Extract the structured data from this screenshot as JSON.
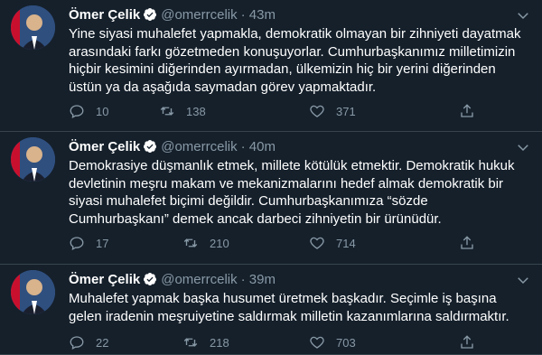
{
  "colors": {
    "background": "#15202b",
    "divider": "#38444d",
    "secondary_text": "#8899a6",
    "verified_badge": "#ffffff"
  },
  "tweets": [
    {
      "author_name": "Ömer Çelik",
      "handle": "@omerrcelik",
      "time": "· 43m",
      "text": "Yine siyasi muhalefet yapmakla, demokratik olmayan bir zihniyeti dayatmak arasındaki farkı gözetmeden konuşuyorlar. Cumhurbaşkanımız milletimizin hiçbir kesimini diğerinden ayırmadan, ülkemizin hiç bir yerini diğerinden üstün ya da aşağıda saymadan görev yapmaktadır.",
      "replies": "10",
      "retweets": "138",
      "likes": "371"
    },
    {
      "author_name": "Ömer Çelik",
      "handle": "@omerrcelik",
      "time": "· 40m",
      "text": "Demokrasiye düşmanlık etmek, millete kötülük etmektir. Demokratik hukuk devletinin meşru makam ve mekanizmalarını hedef almak demokratik bir siyasi muhalefet biçimi değildir. Cumhurbaşkanımıza “sözde Cumhurbaşkanı” demek ancak darbeci zihniyetin bir ürünüdür.",
      "replies": "17",
      "retweets": "210",
      "likes": "714"
    },
    {
      "author_name": "Ömer Çelik",
      "handle": "@omerrcelik",
      "time": "· 39m",
      "text": "Muhalefet yapmak başka husumet üretmek başkadır. Seçimle iş başına gelen iradenin meşruiyetine saldırmak milletin kazanımlarına saldırmaktır.",
      "replies": "22",
      "retweets": "218",
      "likes": "703"
    }
  ]
}
